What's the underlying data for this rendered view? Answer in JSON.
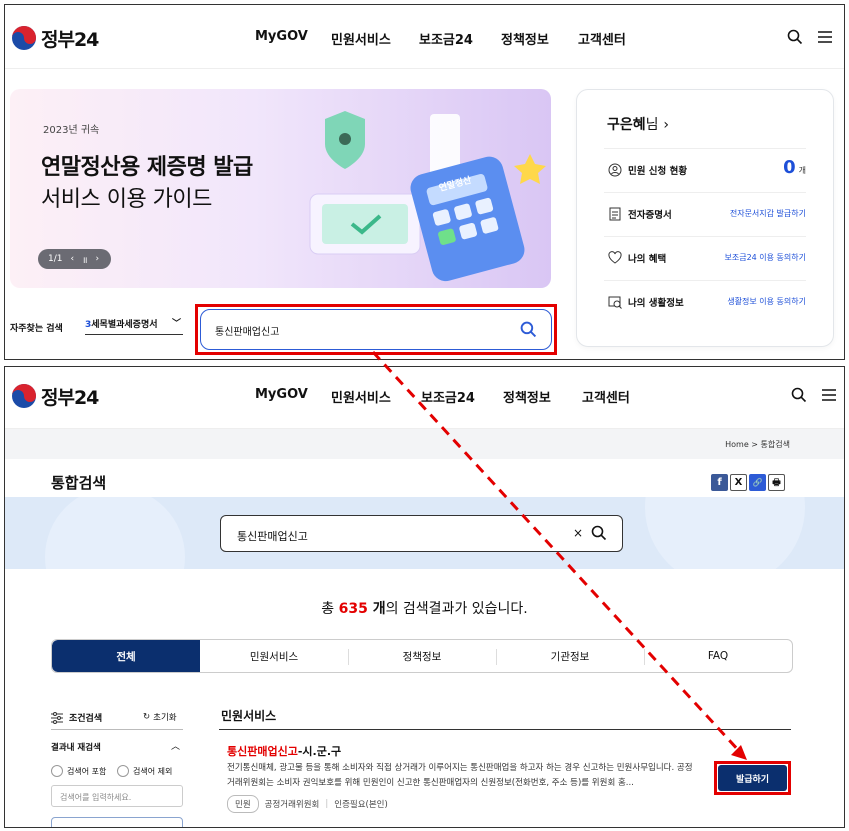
{
  "colors": {
    "accent": "#1d4fd8",
    "navy": "#0b2f6e",
    "highlight": "#e30000"
  },
  "top": {
    "logo": "정부24",
    "nav": [
      "MyGOV",
      "민원서비스",
      "보조금24",
      "정책정보",
      "고객센터"
    ],
    "banner": {
      "subtitle": "2023년 귀속",
      "title_line1": "연말정산용 제증명 발급",
      "title_line2": "서비스 이용 가이드",
      "pager": "1/1",
      "illustration_label": "연말정산"
    },
    "favorites": {
      "label": "자주찾는 검색",
      "num": "3",
      "term": "세목별과세증명서"
    },
    "search": {
      "value": "통신판매업신고"
    },
    "user": {
      "name": "구은혜",
      "suffix": "님",
      "rows": [
        {
          "icon": "user-icon",
          "label": "민원 신청 현황",
          "count": "0",
          "unit": "개"
        },
        {
          "icon": "document-icon",
          "label": "전자증명서",
          "link": "전자문서지갑 발급하기"
        },
        {
          "icon": "heart-icon",
          "label": "나의 혜택",
          "link": "보조금24 이용 동의하기"
        },
        {
          "icon": "life-info-icon",
          "label": "나의 생활정보",
          "link": "생활정보 이용 동의하기"
        }
      ]
    }
  },
  "bottom": {
    "logo": "정부24",
    "nav": [
      "MyGOV",
      "민원서비스",
      "보조금24",
      "정책정보",
      "고객센터"
    ],
    "breadcrumb": "Home > 통합검색",
    "page_title": "통합검색",
    "share": [
      "f",
      "X",
      "🔗",
      "🖶"
    ],
    "search": {
      "value": "통신판매업신고",
      "clear": "×"
    },
    "results": {
      "prefix": "총 ",
      "count": "635",
      "count_suffix": " 개",
      "suffix": "의 검색결과가 있습니다."
    },
    "tabs": [
      "전체",
      "민원서비스",
      "정책정보",
      "기관정보",
      "FAQ"
    ],
    "filter": {
      "title": "조건검색",
      "reset": "초기화",
      "research": "결과내 재검색",
      "opt1": "검색어 포함",
      "opt2": "검색어 제외",
      "placeholder": "검색어를 입력하세요."
    },
    "section_title": "민원서비스",
    "result": {
      "title_hl": "통신판매업신고",
      "title_rest": "-시.군.구",
      "desc": "전기통신매체, 광고물 등을 통해 소비자와 직접 상거래가 이루어지는 통신판매업을 하고자 하는 경우 신고하는 민원사무입니다. 공정거래위원회는 소비자 권익보호를 위해 민원인이 신고한 통신판매업자의 신원정보(전화번호, 주소 등)를 위원회 홈...",
      "tag": "민원",
      "org": "공정거래위원회",
      "auth": "인증필요(본인)",
      "button": "발급하기"
    }
  }
}
